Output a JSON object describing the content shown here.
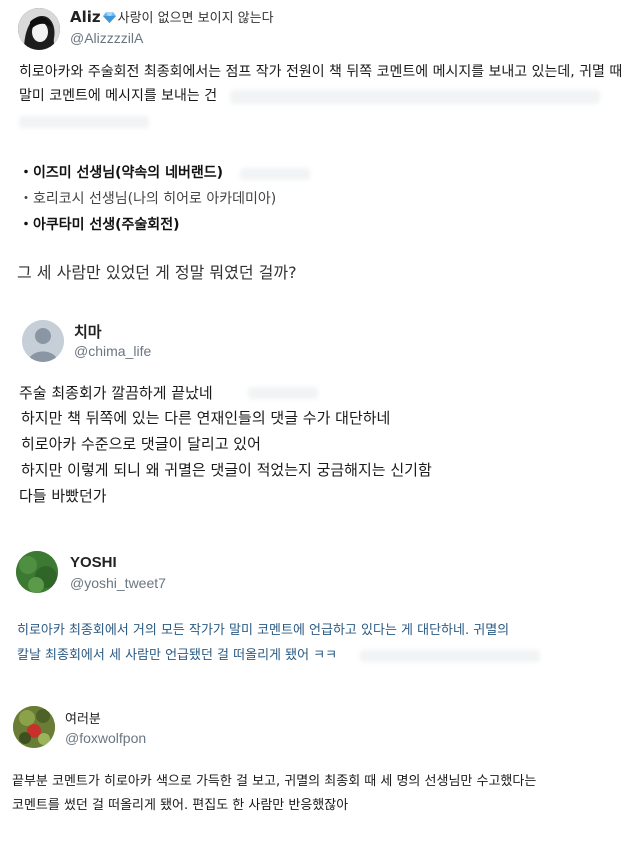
{
  "posts": [
    {
      "author": "Aliz",
      "author_suffix": "사랑이 없으면 보이지 않는다",
      "handle": "@AlizzzzilA",
      "lines": [
        "히로아카와 주술회전 최종회에서는 점프 작가 전원이 책 뒤쪽 코멘트에 메시지를 보내고 있는데, 귀멸 때",
        "말미 코멘트에 메시지를 보내는 건"
      ],
      "list": [
        "・이즈미 선생님(약속의 네버랜드)",
        "・호리코시 선생님(나의 히어로 아카데미아)",
        "・아쿠타미 선생(주술회전)"
      ],
      "closing": "그 세 사람만 있었던 게 정말 뭐였던 걸까?"
    },
    {
      "author": "치마",
      "handle": "@chima_life",
      "lines": [
        "주술 최종회가 깔끔하게 끝났네",
        "하지만 책 뒤쪽에 있는 다른 연재인들의 댓글 수가 대단하네",
        "히로아카 수준으로 댓글이 달리고 있어",
        "하지만 이렇게 되니 왜 귀멸은 댓글이 적었는지 궁금해지는 신기함",
        "다들 바빴던가"
      ]
    },
    {
      "author": "YOSHI",
      "handle": "@yoshi_tweet7",
      "lines": [
        "히로아카 최종회에서 거의 모든 작가가 말미 코멘트에 언급하고 있다는 게 대단하네. 귀멸의",
        "칼날 최종회에서 세 사람만 언급됐던 걸 떠올리게 됐어 ㅋㅋ"
      ]
    },
    {
      "author": "여러분",
      "handle": "@foxwolfpon",
      "lines": [
        "끝부분 코멘트가 히로아카 색으로 가득한 걸 보고, 귀멸의 최종회 때 세 명의 선생님만 수고했다는",
        "코멘트를 썼던 걸 떠올리게 됐어. 편집도 한 사람만 반응했잖아"
      ]
    }
  ],
  "icons": {
    "verified_gem": "diamond-icon"
  },
  "colors": {
    "handle": "#6b7680",
    "text": "#1a1a1a",
    "quote_text": "#2b5b84"
  }
}
